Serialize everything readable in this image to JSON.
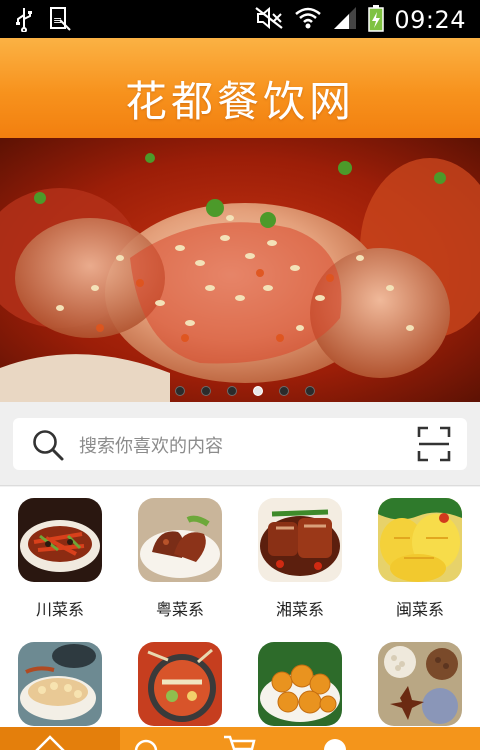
{
  "status_bar": {
    "time": "09:24",
    "icons": [
      "usb-icon",
      "keyboard-icon",
      "mute-icon",
      "wifi-icon",
      "signal-icon",
      "battery-icon"
    ]
  },
  "header": {
    "title": "花都餐饮网"
  },
  "banner": {
    "slide_count": 6,
    "active_index": 3
  },
  "search": {
    "placeholder": "搜索你喜欢的内容"
  },
  "categories": [
    {
      "label": "川菜系"
    },
    {
      "label": "粤菜系"
    },
    {
      "label": "湘菜系"
    },
    {
      "label": "闽菜系"
    },
    {
      "label": ""
    },
    {
      "label": ""
    },
    {
      "label": ""
    },
    {
      "label": ""
    }
  ],
  "tabbar": {
    "items": [
      "home-icon",
      "search-icon",
      "cart-icon",
      "gear-icon",
      "more-icon"
    ],
    "active_index": 0
  },
  "colors": {
    "accent": "#f7921d",
    "header_top": "#fbb244",
    "header_bottom": "#f27f0f"
  }
}
